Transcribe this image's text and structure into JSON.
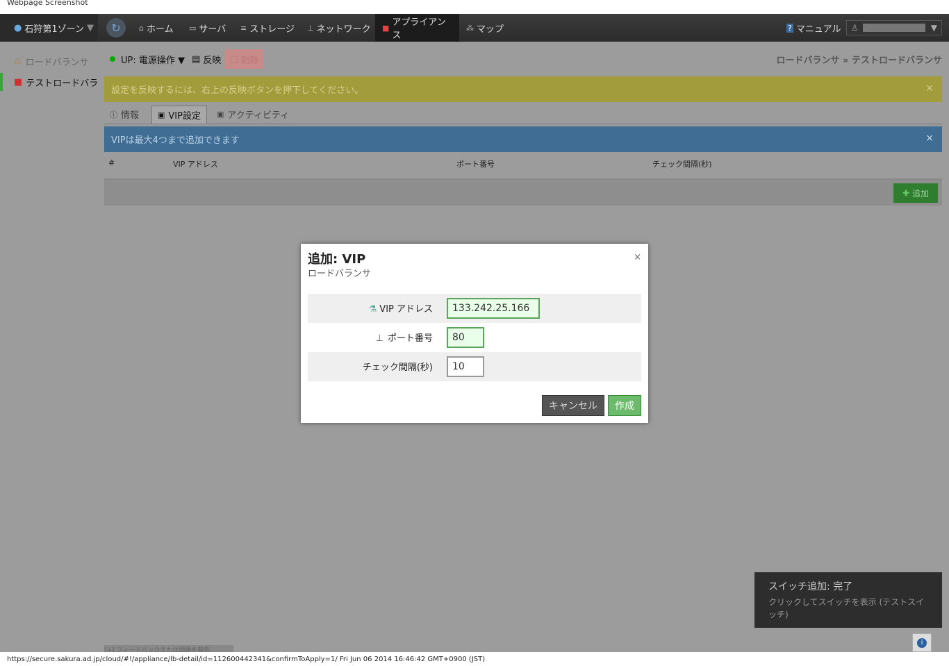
{
  "browser": {
    "caption": "Webpage Screenshot",
    "status_text": "https://secure.sakura.ad.jp/cloud/#!/appliance/lb-detail/id=112600442341&confirmToApply=1/ Fri Jun 06 2014 16:46:42 GMT+0900 (JST)"
  },
  "topbar": {
    "zone": "石狩第1ゾーン",
    "nav": [
      "ホーム",
      "サーバ",
      "ストレージ",
      "ネットワーク",
      "アプライアンス",
      "マップ"
    ],
    "manual": "マニュアル"
  },
  "sidebar": {
    "items": [
      "ロードバランサ",
      "テストロードバランサ"
    ]
  },
  "toolbar": {
    "status": "UP: 電源操作",
    "apply": "反映",
    "delete": "削除"
  },
  "breadcrumb": "ロードバランサ » テストロードバランサ",
  "alerts": {
    "apply_notice": "設定を反映するには、右上の反映ボタンを押下してください。",
    "vip_notice": "VIPは最大4つまで追加できます"
  },
  "tabs": [
    "情報",
    "VIP設定",
    "アクティビティ"
  ],
  "table": {
    "headers": [
      "#",
      "VIP アドレス",
      "ポート番号",
      "チェック間隔(秒)"
    ],
    "add_label": "追加"
  },
  "modal": {
    "title": "追加: VIP",
    "subtitle": "ロードバランサ",
    "fields": [
      {
        "label": "VIP アドレス",
        "value": "133.242.25.166"
      },
      {
        "label": "ポート番号",
        "value": "80"
      },
      {
        "label": "チェック間隔(秒)",
        "value": "10"
      }
    ],
    "cancel": "キャンセル",
    "create": "作成"
  },
  "toast": {
    "title": "スイッチ追加: 完了",
    "body": "クリックしてスイッチを表示 (テストスイッチ)"
  },
  "footer_note": "[+] フィードバックまたは問題を報告"
}
